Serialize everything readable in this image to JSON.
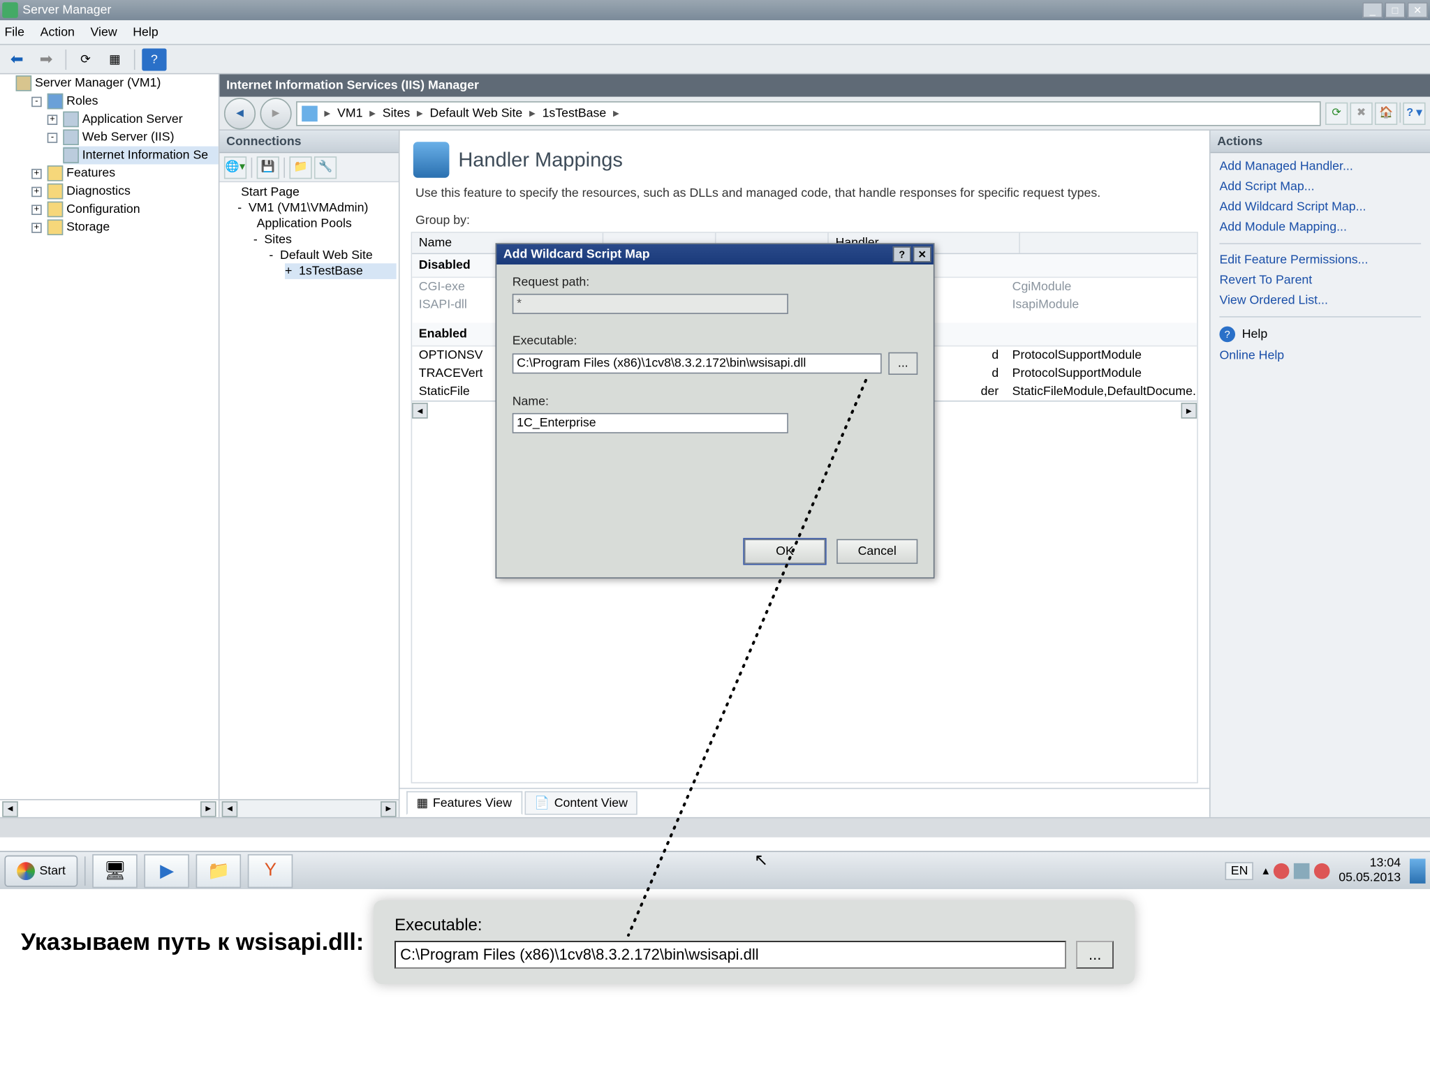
{
  "window": {
    "title": "Server Manager"
  },
  "menubar": [
    "File",
    "Action",
    "View",
    "Help"
  ],
  "tree": {
    "root": "Server Manager (VM1)",
    "roles": "Roles",
    "appserver": "Application Server",
    "webserver": "Web Server (IIS)",
    "iis": "Internet Information Se",
    "features": "Features",
    "diagnostics": "Diagnostics",
    "configuration": "Configuration",
    "storage": "Storage"
  },
  "iis": {
    "title": "Internet Information Services (IIS) Manager",
    "breadcrumb": [
      "VM1",
      "Sites",
      "Default Web Site",
      "1sTestBase"
    ]
  },
  "connections": {
    "header": "Connections",
    "start": "Start Page",
    "server": "VM1 (VM1\\VMAdmin)",
    "apppools": "Application Pools",
    "sites": "Sites",
    "defaultsite": "Default Web Site",
    "testbase": "1sTestBase"
  },
  "feature": {
    "title": "Handler Mappings",
    "desc": "Use this feature to specify the resources, such as DLLs and managed code, that handle responses for specific request types.",
    "groupby": "Group by:",
    "cols": {
      "name": "Name",
      "handler": "Handler"
    },
    "group1": "Disabled",
    "group2": "Enabled",
    "rows_disabled": [
      {
        "name": "CGI-exe",
        "handler": "CgiModule"
      },
      {
        "name": "ISAPI-dll",
        "handler": "IsapiModule"
      }
    ],
    "rows_enabled": [
      {
        "name": "OPTIONSV",
        "handler": "ProtocolSupportModule",
        "tail": "d"
      },
      {
        "name": "TRACEVert",
        "handler": "ProtocolSupportModule",
        "tail": "d"
      },
      {
        "name": "StaticFile",
        "handler": "StaticFileModule,DefaultDocume...",
        "tail": "der"
      }
    ],
    "tabs": {
      "features": "Features View",
      "content": "Content View"
    }
  },
  "actions": {
    "header": "Actions",
    "links": [
      "Add Managed Handler...",
      "Add Script Map...",
      "Add Wildcard Script Map...",
      "Add Module Mapping..."
    ],
    "links2": [
      "Edit Feature Permissions...",
      "Revert To Parent",
      "View Ordered List..."
    ],
    "help": "Help",
    "online": "Online Help"
  },
  "dialog": {
    "title": "Add Wildcard Script Map",
    "reqpath_lbl": "Request path:",
    "reqpath_val": "*",
    "exec_lbl": "Executable:",
    "exec_val": "C:\\Program Files (x86)\\1cv8\\8.3.2.172\\bin\\wsisapi.dll",
    "browse": "...",
    "name_lbl": "Name:",
    "name_val": "1C_Enterprise",
    "ok": "OK",
    "cancel": "Cancel"
  },
  "taskbar": {
    "start": "Start",
    "lang": "EN",
    "time": "13:04",
    "date": "05.05.2013"
  },
  "callout": {
    "label": "Указываем путь к wsisapi.dll:",
    "exec_lbl": "Executable:",
    "exec_val": "C:\\Program Files (x86)\\1cv8\\8.3.2.172\\bin\\wsisapi.dll",
    "browse": "..."
  }
}
